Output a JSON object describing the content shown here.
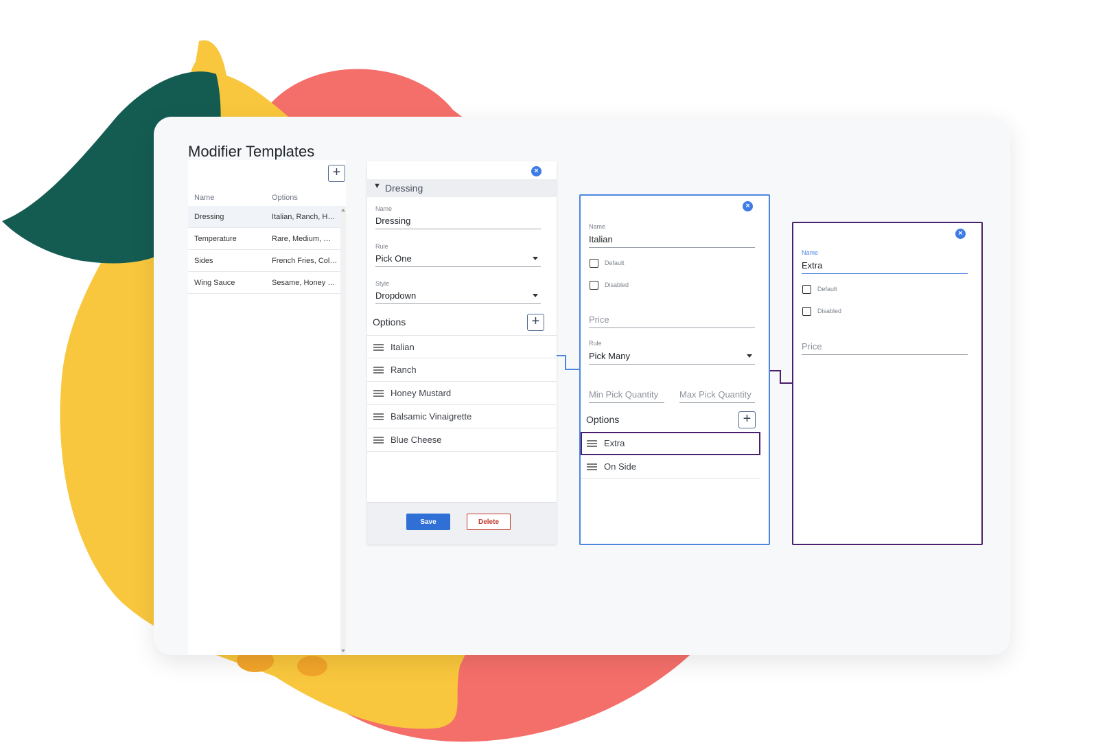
{
  "colors": {
    "card_bg": "#f7f8fa",
    "accent_blue": "#4b86e0",
    "accent_purple": "#4a1f6e",
    "save_blue": "#2f6fd6",
    "delete_red": "#c0392b",
    "blob_yellow": "#f9c73d",
    "blob_coral": "#f56f6a",
    "blob_green": "#145c52"
  },
  "page": {
    "title": "Modifier Templates"
  },
  "list": {
    "add_icon": "plus-icon",
    "headers": {
      "name": "Name",
      "options": "Options"
    },
    "rows": [
      {
        "name": "Dressing",
        "options": "Italian, Ranch, Ho..."
      },
      {
        "name": "Temperature",
        "options": "Rare, Medium, Well"
      },
      {
        "name": "Sides",
        "options": "French Fries, Cole..."
      },
      {
        "name": "Wing Sauce",
        "options": "Sesame, Honey G..."
      }
    ]
  },
  "dressing_panel": {
    "header": "Dressing",
    "name_label": "Name",
    "name_value": "Dressing",
    "rule_label": "Rule",
    "rule_value": "Pick One",
    "style_label": "Style",
    "style_value": "Dropdown",
    "options_label": "Options",
    "options": [
      "Italian",
      "Ranch",
      "Honey Mustard",
      "Balsamic Vinaigrette",
      "Blue Cheese"
    ],
    "save_label": "Save",
    "delete_label": "Delete"
  },
  "italian_panel": {
    "name_label": "Name",
    "name_value": "Italian",
    "default_label": "Default",
    "disabled_label": "Disabled",
    "price_placeholder": "Price",
    "rule_label": "Rule",
    "rule_value": "Pick Many",
    "min_placeholder": "Min Pick Quantity",
    "max_placeholder": "Max Pick Quantity",
    "options_label": "Options",
    "options": [
      "Extra",
      "On Side"
    ]
  },
  "extra_panel": {
    "name_label": "Name",
    "name_value": "Extra",
    "default_label": "Default",
    "disabled_label": "Disabled",
    "price_placeholder": "Price"
  }
}
